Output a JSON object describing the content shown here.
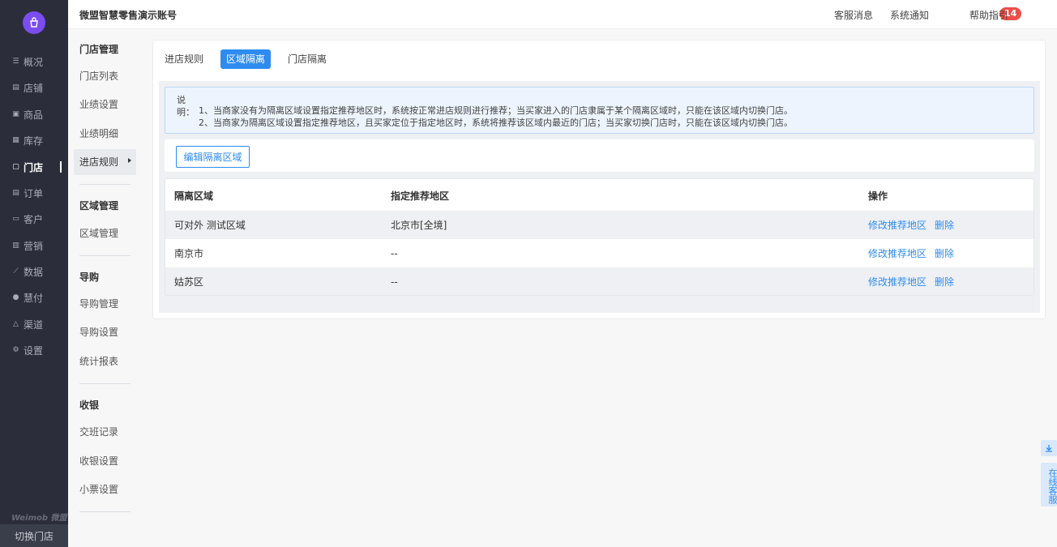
{
  "nav": {
    "items": [
      {
        "label": "概况",
        "icon": "overview-icon"
      },
      {
        "label": "店铺",
        "icon": "shop-icon"
      },
      {
        "label": "商品",
        "icon": "goods-icon"
      },
      {
        "label": "库存",
        "icon": "stock-icon"
      },
      {
        "label": "门店",
        "icon": "store-icon"
      },
      {
        "label": "订单",
        "icon": "order-icon"
      },
      {
        "label": "客户",
        "icon": "customer-icon"
      },
      {
        "label": "营销",
        "icon": "marketing-icon"
      },
      {
        "label": "数据",
        "icon": "data-icon"
      },
      {
        "label": "慧付",
        "icon": "pay-icon"
      },
      {
        "label": "渠道",
        "icon": "channel-icon"
      },
      {
        "label": "设置",
        "icon": "settings-icon"
      }
    ],
    "brand": "Weimob 微盟",
    "switch_store": "切换门店"
  },
  "sub": {
    "g1": "门店管理",
    "g1_items": [
      "门店列表",
      "业绩设置",
      "业绩明细",
      "进店规则"
    ],
    "g2": "区域管理",
    "g2_items": [
      "区域管理"
    ],
    "g3": "导购",
    "g3_items": [
      "导购管理",
      "导购设置",
      "统计报表"
    ],
    "g4": "收银",
    "g4_items": [
      "交班记录",
      "收银设置",
      "小票设置"
    ]
  },
  "header": {
    "account": "微盟智慧零售演示账号",
    "service": "客服消息",
    "notice": "系统通知",
    "notice_count": "14",
    "help": "帮助指引"
  },
  "tabs": [
    "进店规则",
    "区域隔离",
    "门店隔离"
  ],
  "notice": {
    "label": "说明：",
    "line1": "1、当商家没有为隔离区域设置指定推荐地区时，系统按正常进店规则进行推荐；当买家进入的门店隶属于某个隔离区域时，只能在该区域内切换门店。",
    "line2": "2、当商家为隔离区域设置指定推荐地区，且买家定位于指定地区时，系统将推荐该区域内最近的门店；当买家切换门店时，只能在该区域内切换门店。"
  },
  "edit_button": "编辑隔离区域",
  "table": {
    "headers": [
      "隔离区域",
      "指定推荐地区",
      "操作"
    ],
    "rows": [
      {
        "area": "可对外 测试区域",
        "region": "北京市[全境]"
      },
      {
        "area": "南京市",
        "region": "--"
      },
      {
        "area": "姑苏区",
        "region": "--"
      }
    ],
    "action_edit": "修改推荐地区",
    "action_delete": "删除"
  },
  "float": {
    "online_service": "在线客服"
  }
}
